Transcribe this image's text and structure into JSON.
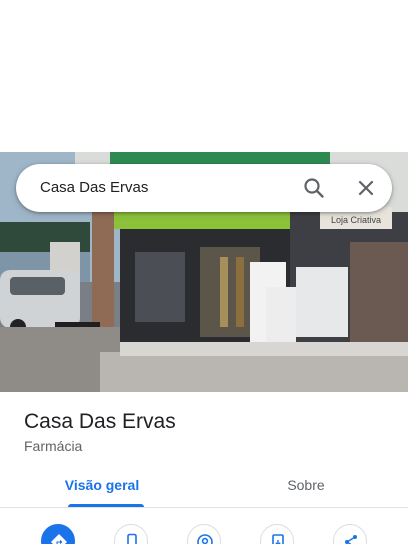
{
  "search": {
    "query": "Casa Das Ervas"
  },
  "photo": {
    "sign_text": "Loja Criativa"
  },
  "place": {
    "name": "Casa Das Ervas",
    "category": "Farmácia"
  },
  "tabs": [
    {
      "label": "Visão geral",
      "selected": true
    },
    {
      "label": "Sobre",
      "selected": false
    }
  ],
  "actions": [
    {
      "icon": "directions-icon"
    },
    {
      "icon": "phone-icon"
    },
    {
      "icon": "location-icon"
    },
    {
      "icon": "save-icon"
    },
    {
      "icon": "share-icon"
    }
  ],
  "colors": {
    "accent": "#1a73e8",
    "text_primary": "#202124",
    "text_secondary": "#5f6368"
  }
}
